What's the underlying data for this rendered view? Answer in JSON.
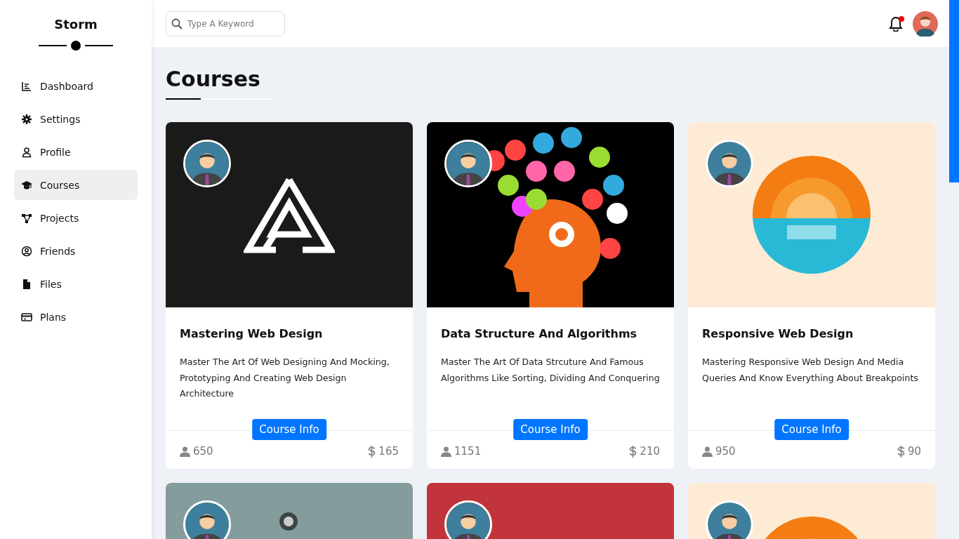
{
  "sidebar": {
    "brand": "Storm",
    "items": [
      {
        "label": "Dashboard",
        "selected": false
      },
      {
        "label": "Settings",
        "selected": false
      },
      {
        "label": "Profile",
        "selected": false
      },
      {
        "label": "Courses",
        "selected": true
      },
      {
        "label": "Projects",
        "selected": false
      },
      {
        "label": "Friends",
        "selected": false
      },
      {
        "label": "Files",
        "selected": false
      },
      {
        "label": "Plans",
        "selected": false
      }
    ]
  },
  "header": {
    "search": {
      "placeholder": "Type A Keyword"
    },
    "notification": {
      "unread": true
    }
  },
  "page_title": "Courses",
  "courses": [
    {
      "kind": "triangle-logo",
      "title": "Mastering Web Design",
      "description": "Master The Art Of Web Designing And Mocking, Prototyping And Creating Web Design Architecture",
      "button": "Course Info",
      "students": "650",
      "price": "165"
    },
    {
      "kind": "head-icons",
      "title": "Data Structure And Algorithms",
      "description": "Master The Art Of Data Strcuture And Famous Algorithms Like Sorting, Dividing And Conquering",
      "button": "Course Info",
      "students": "1151",
      "price": "210"
    },
    {
      "kind": "sun-sea",
      "title": "Responsive Web Design",
      "description": "Mastering Responsive Web Design And Media Queries And Know Everything About Breakpoints",
      "button": "Course Info",
      "students": "950",
      "price": "90"
    },
    {
      "kind": "grey-pin"
    },
    {
      "kind": "red-pattern"
    },
    {
      "kind": "sun-sea"
    }
  ]
}
